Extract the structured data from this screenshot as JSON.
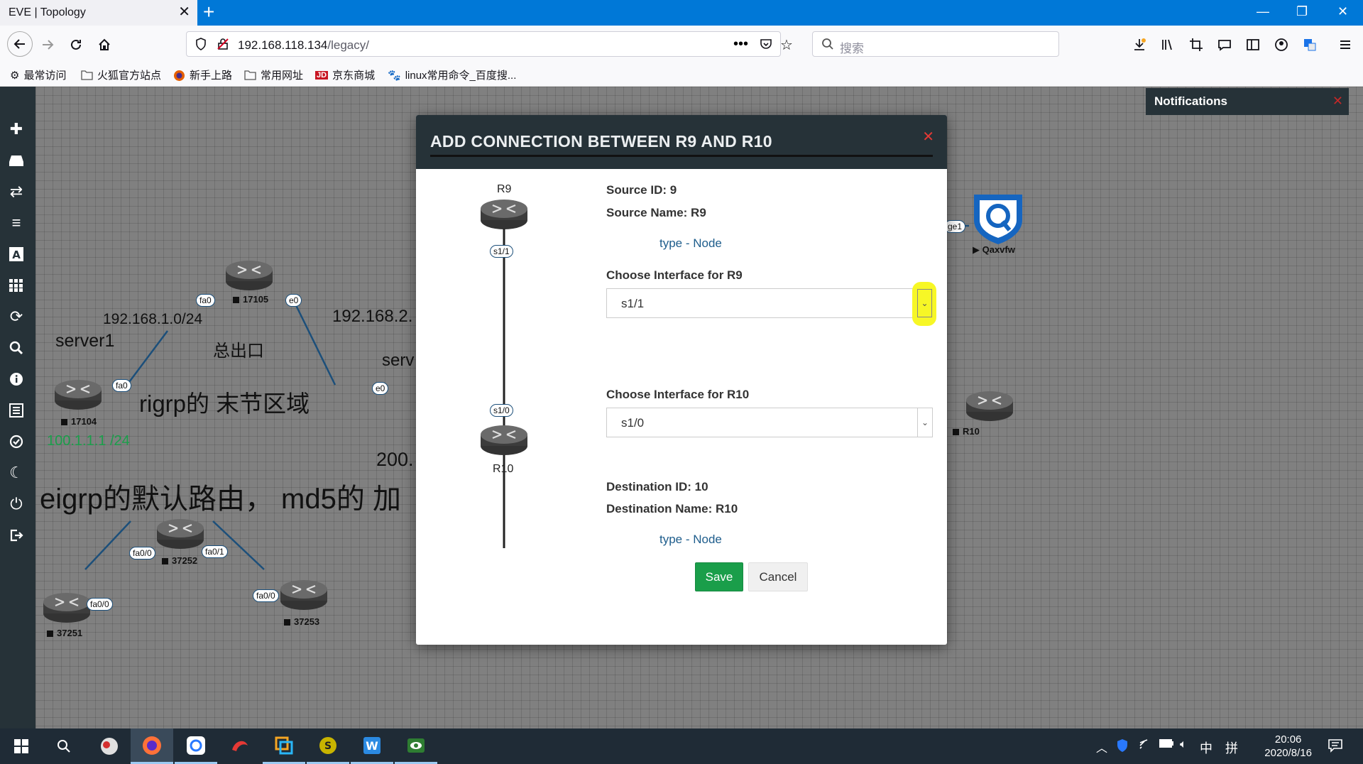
{
  "browser": {
    "tab_title": "EVE | Topology",
    "url_host": "192.168.118.134",
    "url_path": "/legacy/",
    "search_placeholder": "搜索",
    "bookmarks": [
      "最常访问",
      "火狐官方站点",
      "新手上路",
      "常用网址",
      "京东商城",
      "linux常用命令_百度搜..."
    ]
  },
  "notifications": {
    "title": "Notifications"
  },
  "canvas": {
    "routers": [
      {
        "label": "17105"
      },
      {
        "label": "17104"
      },
      {
        "label": "R10"
      },
      {
        "label": "37252"
      },
      {
        "label": "37251"
      },
      {
        "label": "37253"
      }
    ],
    "interfaces": [
      "fa0",
      "e0",
      "fa0",
      "e0",
      "fa0/0",
      "fa0/1",
      "fa0/0",
      "fa0/0",
      "ge1"
    ],
    "texts": {
      "net1": "192.168.1.0/24",
      "net2": "192.168.2.",
      "server1": "server1",
      "exit": "总出口",
      "serv": "serv",
      "stub": "rigrp的 末节区域",
      "ip100": "100.1.1.1 /24",
      "ip200": "200.",
      "eigrp": "eigrp的默认路由，  md5的 加"
    },
    "qaxvfw_label": "Qaxvfw"
  },
  "modal": {
    "title": "ADD CONNECTION BETWEEN R9 AND R10",
    "src_node": "R9",
    "dst_node": "R10",
    "src_iface_tag": "s1/1",
    "dst_iface_tag": "s1/0",
    "source_id": "Source ID: 9",
    "source_name": "Source Name: R9",
    "src_type_label": "type",
    "src_type_value": "Node",
    "choose_src_label": "Choose Interface for R9",
    "src_select_value": "s1/1",
    "choose_dst_label": "Choose Interface for R10",
    "dst_select_value": "s1/0",
    "dest_id": "Destination ID: 10",
    "dest_name": "Destination Name: R10",
    "dst_type_label": "type",
    "dst_type_value": "Node",
    "save_label": "Save",
    "cancel_label": "Cancel"
  },
  "taskbar": {
    "time": "20:06",
    "date": "2020/8/16",
    "ime": "中",
    "ime2": "拼"
  }
}
